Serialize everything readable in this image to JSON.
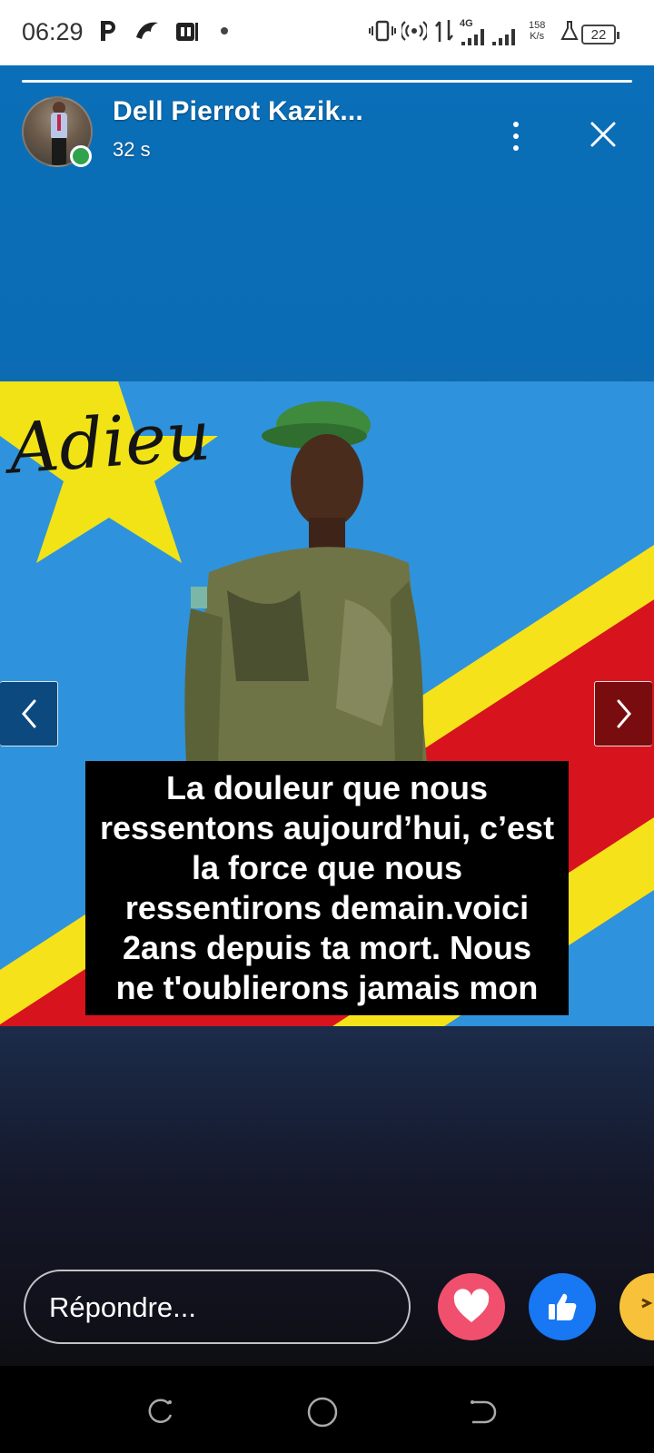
{
  "status_bar": {
    "time": "06:29",
    "network_type": "4G",
    "speed_value": "158",
    "speed_unit": "K/s",
    "battery": "22"
  },
  "story": {
    "author": "Dell Pierrot Kazik...",
    "time_ago": "32 s",
    "image": {
      "script_text": "Adieu",
      "caption": "La douleur que nous\nressentons aujourd’hui, c’est\nla force que nous\nressentirons demain.voici\n2ans depuis ta mort. Nous\nne t'oublierons jamais mon"
    }
  },
  "reply": {
    "placeholder": "Répondre..."
  },
  "reactions": [
    "love",
    "like",
    "haha"
  ],
  "colors": {
    "online": "#31a24c",
    "like": "#1877f2",
    "love": "#f0506e",
    "haha": "#f7c23a"
  }
}
